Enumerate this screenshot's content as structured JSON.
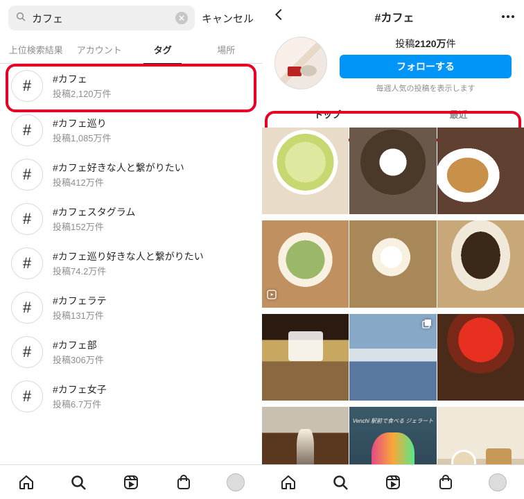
{
  "left": {
    "search_query": "カフェ",
    "cancel": "キャンセル",
    "tabs": [
      "上位検索結果",
      "アカウント",
      "タグ",
      "場所"
    ],
    "active_tab_index": 2,
    "tags": [
      {
        "name": "#カフェ",
        "count": "投稿2,120万件"
      },
      {
        "name": "#カフェ巡り",
        "count": "投稿1,085万件"
      },
      {
        "name": "#カフェ好きな人と繋がりたい",
        "count": "投稿412万件"
      },
      {
        "name": "#カフェスタグラム",
        "count": "投稿152万件"
      },
      {
        "name": "#カフェ巡り好きな人と繋がりたい",
        "count": "投稿74.2万件"
      },
      {
        "name": "#カフェラテ",
        "count": "投稿131万件"
      },
      {
        "name": "#カフェ部",
        "count": "投稿306万件"
      },
      {
        "name": "#カフェ女子",
        "count": "投稿6.7万件"
      }
    ]
  },
  "right": {
    "title": "#カフェ",
    "post_count_prefix": "投稿",
    "post_count_number": "2120万",
    "post_count_suffix": "件",
    "follow": "フォローする",
    "note": "毎週人気の投稿を表示します",
    "sort_tabs": [
      "トップ",
      "最近"
    ],
    "active_sort_index": 0,
    "gelato_label": "Venchi\n駅前で食べる\nジェラート"
  },
  "highlight_color": "#e60023"
}
